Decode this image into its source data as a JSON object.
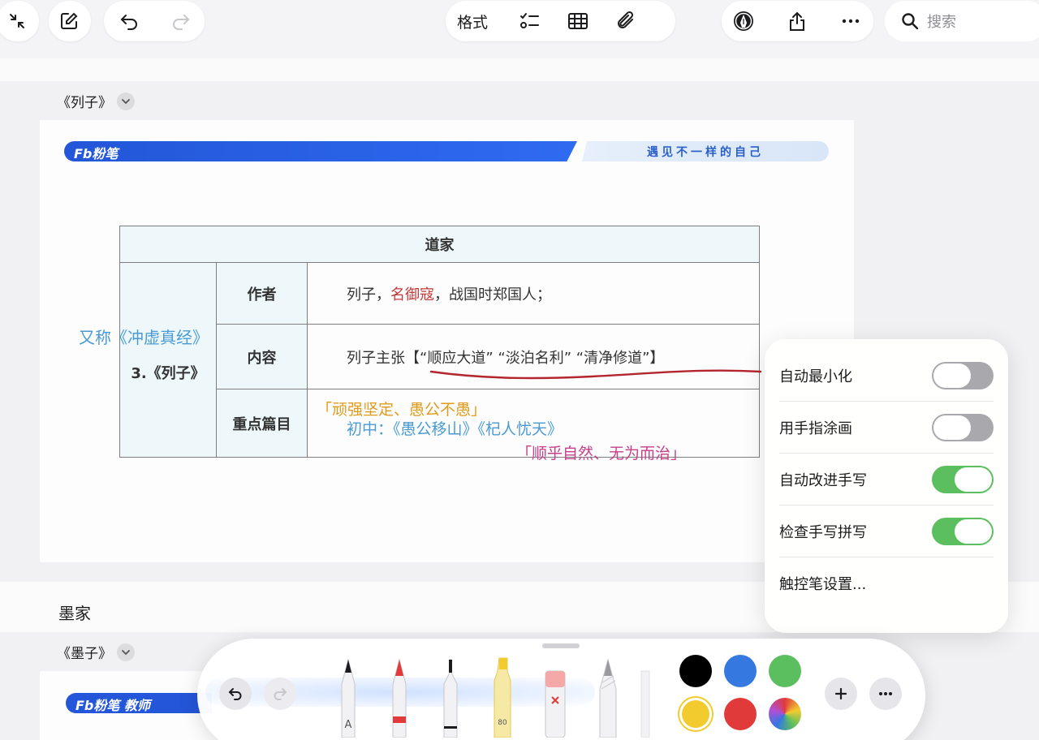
{
  "toolbar": {
    "format_label": "格式",
    "search_placeholder": "搜索"
  },
  "note": {
    "section1_title": "《列子》",
    "section2_heading": "墨家",
    "section3_title": "《墨子》"
  },
  "doc": {
    "banner_logo": "Fb粉笔",
    "banner_slogan": "遇见不一样的自己",
    "table": {
      "header": "道家",
      "left_label": "3.《列子》",
      "rows": [
        {
          "label": "作者",
          "pre": "列子，",
          "highlight": "名御寇",
          "post": "，战国时郑国人；"
        },
        {
          "label": "内容",
          "text": "列子主张【“顺应大道” “淡泊名利” “清净修道”】"
        },
        {
          "label": "重点篇目"
        }
      ]
    },
    "handwriting": {
      "alias": "又称《冲虚真经》",
      "quote1": "「顽强坚定、愚公不愚」",
      "stories": "初中：《愚公移山》《杞人忧天》",
      "quote2": "「顺乎自然、无为而治」"
    },
    "banner2_logo": "Fb粉笔 教师"
  },
  "popover": {
    "items": [
      {
        "label": "自动最小化",
        "on": false
      },
      {
        "label": "用手指涂画",
        "on": false
      },
      {
        "label": "自动改进手写",
        "on": true
      },
      {
        "label": "检查手写拼写",
        "on": true
      }
    ],
    "pencil_settings": "触控笔设置..."
  },
  "palette": {
    "highlighter_label": "80",
    "colors": [
      "#000000",
      "#3478e0",
      "#5bbf5f",
      "#f2cc2f",
      "#e03a3a",
      "multicolor"
    ],
    "selected_color": "#f2cc2f"
  }
}
